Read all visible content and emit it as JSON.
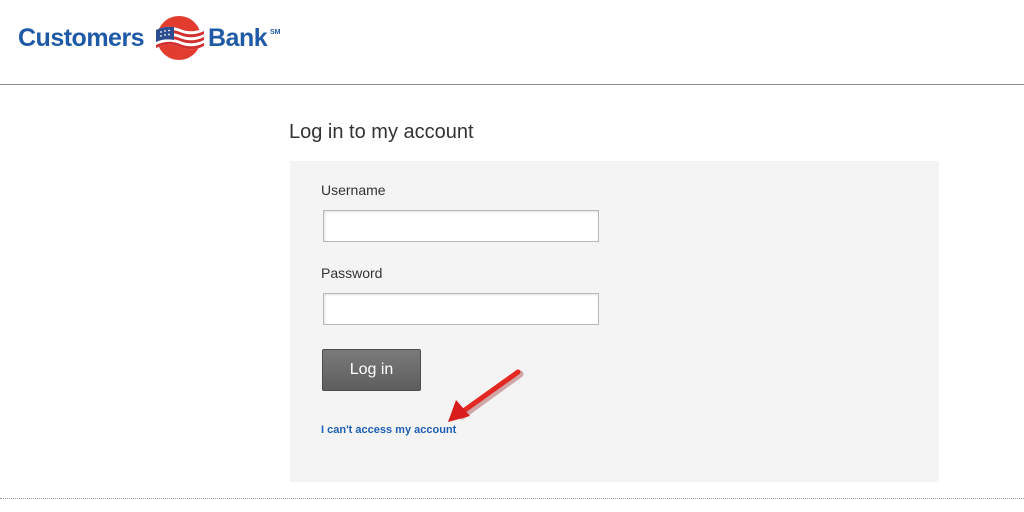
{
  "header": {
    "logo_left": "Customers",
    "logo_right": "Bank",
    "logo_mark": "SM"
  },
  "login": {
    "title": "Log in to my account",
    "username_label": "Username",
    "username_value": "",
    "password_label": "Password",
    "password_value": "",
    "submit_label": "Log in",
    "help_link": "I can't access my account"
  },
  "annotation": {
    "arrow_color": "#e02020"
  },
  "colors": {
    "brand_blue": "#1f5aa6",
    "link_blue": "#1d5fb5",
    "panel_bg": "#f4f4f4",
    "button_gray": "#6b6b6b"
  }
}
